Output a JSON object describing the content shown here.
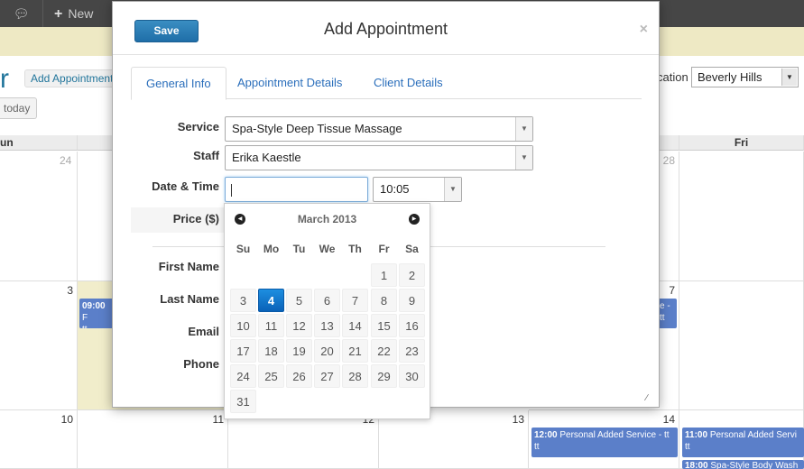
{
  "topbar": {
    "comment_icon": "comment-icon",
    "new_label": "New"
  },
  "page": {
    "title_fragment": "r",
    "add_appointment_tab": "Add Appointment",
    "today_label": "today"
  },
  "location": {
    "label": "cation",
    "value": "Beverly Hills"
  },
  "calendar": {
    "headers": {
      "sun": "un",
      "fri": "Fri"
    },
    "day_numbers": {
      "d24": "24",
      "d28": "28",
      "d3": "3",
      "d7": "7",
      "d10": "10",
      "d11": "11",
      "d12": "12",
      "d13": "13",
      "d14": "14"
    },
    "events": {
      "e1_time": "09:00",
      "e1_text": "F",
      "e1_suffix": "tt",
      "e2_text": "e -",
      "e2_suffix": "tt",
      "e3_time": "12:00",
      "e3_text": "Personal Added Service - tt",
      "e3_suffix": "tt",
      "e4_time": "11:00",
      "e4_text": "Personal Added Servi",
      "e4_suffix": "tt",
      "e5_time": "18:00",
      "e5_text": "Spa-Style Body Wash"
    }
  },
  "modal": {
    "save_label": "Save",
    "title": "Add Appointment",
    "close_glyph": "×",
    "tabs": [
      "General Info",
      "Appointment Details",
      "Client Details"
    ],
    "service_label": "Service",
    "service_value": "Spa-Style Deep Tissue Massage",
    "staff_label": "Staff",
    "staff_value": "Erika Kaestle",
    "datetime_label": "Date & Time",
    "time_value": "10:05",
    "price_label": "Price ($)",
    "first_name_label": "First Name",
    "last_name_label": "Last Name",
    "email_label": "Email",
    "phone_label": "Phone"
  },
  "datepicker": {
    "month_label": "March 2013",
    "dow": [
      "Su",
      "Mo",
      "Tu",
      "We",
      "Th",
      "Fr",
      "Sa"
    ],
    "days": [
      "1",
      "2",
      "3",
      "4",
      "5",
      "6",
      "7",
      "8",
      "9",
      "10",
      "11",
      "12",
      "13",
      "14",
      "15",
      "16",
      "17",
      "18",
      "19",
      "20",
      "21",
      "22",
      "23",
      "24",
      "25",
      "26",
      "27",
      "28",
      "29",
      "30",
      "31"
    ],
    "selected_day": "4"
  }
}
